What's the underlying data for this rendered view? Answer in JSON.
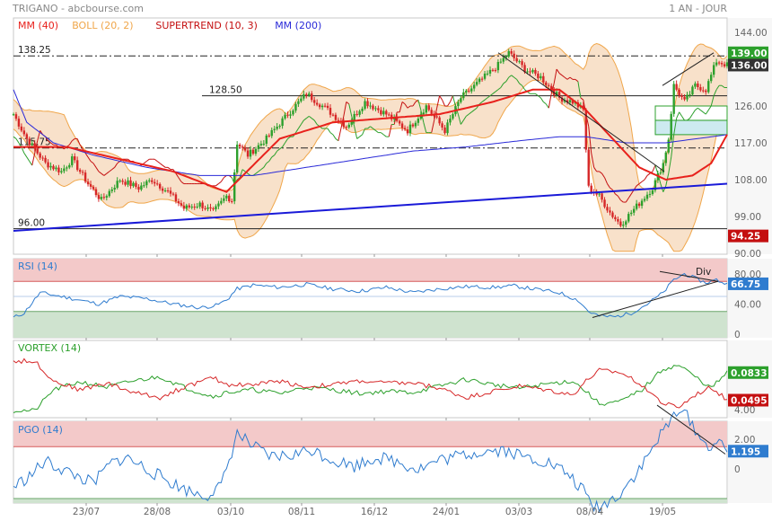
{
  "header": {
    "title": "TRIGANO - abcbourse.com",
    "period": "1 AN - JOUR"
  },
  "colors": {
    "mm40": "#e8211c",
    "boll": "#f0a64a",
    "supertrend": "#c40f10",
    "mm200": "#2a2ad8",
    "up": "#2ca02c",
    "down": "#d62728",
    "rsi": "#2f7ccf",
    "vortex_plus": "#2ca02c",
    "vortex_minus": "#d62728",
    "pgo": "#2f7ccf",
    "zone_high": "#f3c9c9",
    "zone_low": "#cfe3cf"
  },
  "x_axis": {
    "labels": [
      "23/07",
      "28/08",
      "03/10",
      "08/11",
      "16/12",
      "24/01",
      "03/03",
      "08/04",
      "19/05"
    ]
  },
  "chart_data": [
    {
      "type": "candlestick",
      "panel": "price",
      "legend": [
        {
          "name": "MM (40)",
          "color": "#e8211c"
        },
        {
          "name": "BOLL (20, 2)",
          "color": "#f0a64a"
        },
        {
          "name": "SUPERTREND (10, 3)",
          "color": "#c40f10"
        },
        {
          "name": "MM (200)",
          "color": "#2a2ad8"
        }
      ],
      "yticks": [
        90.0,
        99.0,
        108.0,
        117.0,
        126.0,
        135.0,
        144.0
      ],
      "ylim": [
        90,
        144
      ],
      "ytick_labels": [
        "90.00",
        "99.00",
        "108.00",
        "117.00",
        "126.00",
        "",
        "144.00"
      ],
      "hlines": [
        {
          "label": "138.25",
          "value": 138.25,
          "style": "dashdot"
        },
        {
          "label": "128.50",
          "value": 128.5,
          "style": "solid"
        },
        {
          "label": "115.75",
          "value": 115.75,
          "style": "dashdot"
        },
        {
          "label": "96.00",
          "value": 96.0,
          "style": "solid"
        }
      ],
      "last_values": [
        {
          "label": "139.00",
          "value": 139.0,
          "color": "#2ca02c"
        },
        {
          "label": "136.00",
          "value": 136.0,
          "color": "#333333"
        },
        {
          "label": "94.25",
          "value": 94.25,
          "color": "#c40f10"
        }
      ],
      "anchors_close": [
        [
          0,
          124
        ],
        [
          5,
          118
        ],
        [
          12,
          112
        ],
        [
          18,
          110
        ],
        [
          22,
          113
        ],
        [
          28,
          107
        ],
        [
          33,
          103
        ],
        [
          40,
          108
        ],
        [
          47,
          106
        ],
        [
          52,
          108
        ],
        [
          58,
          105
        ],
        [
          64,
          101
        ],
        [
          70,
          102
        ],
        [
          75,
          100
        ],
        [
          80,
          104
        ],
        [
          82,
          103
        ],
        [
          84,
          117
        ],
        [
          88,
          114
        ],
        [
          95,
          118
        ],
        [
          103,
          124
        ],
        [
          110,
          129
        ],
        [
          118,
          125
        ],
        [
          125,
          121
        ],
        [
          132,
          127
        ],
        [
          140,
          124
        ],
        [
          148,
          120
        ],
        [
          155,
          126
        ],
        [
          162,
          120
        ],
        [
          168,
          128
        ],
        [
          175,
          132
        ],
        [
          182,
          136
        ],
        [
          186,
          139
        ],
        [
          192,
          135
        ],
        [
          198,
          133
        ],
        [
          205,
          128
        ],
        [
          210,
          127
        ],
        [
          214,
          125
        ],
        [
          216,
          106
        ],
        [
          220,
          104
        ],
        [
          224,
          100
        ],
        [
          228,
          97
        ],
        [
          232,
          100
        ],
        [
          236,
          103
        ],
        [
          240,
          106
        ],
        [
          244,
          112
        ],
        [
          246,
          118
        ],
        [
          248,
          131
        ],
        [
          252,
          127
        ],
        [
          256,
          131
        ],
        [
          260,
          130
        ],
        [
          264,
          137
        ],
        [
          268,
          136
        ]
      ],
      "anchors_mm40": [
        [
          0,
          116
        ],
        [
          20,
          116
        ],
        [
          40,
          113
        ],
        [
          60,
          110
        ],
        [
          80,
          105
        ],
        [
          100,
          118
        ],
        [
          120,
          122
        ],
        [
          140,
          123
        ],
        [
          160,
          124
        ],
        [
          180,
          127
        ],
        [
          195,
          130
        ],
        [
          205,
          130
        ],
        [
          215,
          125
        ],
        [
          225,
          118
        ],
        [
          235,
          111
        ],
        [
          245,
          108
        ],
        [
          255,
          109
        ],
        [
          262,
          112
        ],
        [
          268,
          119
        ]
      ],
      "anchors_mm200": [
        [
          0,
          130
        ],
        [
          5,
          122
        ],
        [
          15,
          117
        ],
        [
          30,
          114
        ],
        [
          50,
          111
        ],
        [
          70,
          109
        ],
        [
          90,
          109
        ],
        [
          110,
          111
        ],
        [
          130,
          113
        ],
        [
          150,
          115
        ],
        [
          170,
          116
        ],
        [
          190,
          117.5
        ],
        [
          205,
          118.5
        ],
        [
          215,
          118.5
        ],
        [
          230,
          117
        ],
        [
          245,
          117
        ],
        [
          268,
          119
        ]
      ],
      "trendline_support": {
        "points": [
          [
            0,
            95.5
          ],
          [
            268,
            107
          ]
        ],
        "color": "#1a1ad8"
      }
    },
    {
      "type": "line",
      "panel": "rsi",
      "legend": [
        {
          "name": "RSI (14)",
          "color": "#2f7ccf"
        }
      ],
      "yticks": [
        0,
        40,
        80
      ],
      "ytick_labels": [
        "0",
        "40.00",
        "80.00"
      ],
      "ylim": [
        0,
        100
      ],
      "zones": [
        {
          "from": 70,
          "to": 100,
          "color": "#f3c9c9"
        },
        {
          "from": 0,
          "to": 30,
          "color": "#cfe3cf"
        }
      ],
      "midline": 50,
      "last_values": [
        {
          "label": "66.75",
          "value": 66.75,
          "color": "#2f7ccf"
        }
      ],
      "annotation": "Div",
      "anchors": [
        [
          0,
          22
        ],
        [
          4,
          28
        ],
        [
          10,
          55
        ],
        [
          18,
          50
        ],
        [
          25,
          45
        ],
        [
          32,
          40
        ],
        [
          40,
          50
        ],
        [
          50,
          47
        ],
        [
          60,
          40
        ],
        [
          70,
          35
        ],
        [
          76,
          38
        ],
        [
          80,
          45
        ],
        [
          84,
          60
        ],
        [
          90,
          65
        ],
        [
          100,
          62
        ],
        [
          110,
          66
        ],
        [
          120,
          60
        ],
        [
          130,
          57
        ],
        [
          140,
          62
        ],
        [
          150,
          55
        ],
        [
          160,
          60
        ],
        [
          170,
          63
        ],
        [
          180,
          62
        ],
        [
          188,
          64
        ],
        [
          195,
          60
        ],
        [
          205,
          55
        ],
        [
          212,
          45
        ],
        [
          216,
          30
        ],
        [
          220,
          24
        ],
        [
          226,
          23
        ],
        [
          232,
          28
        ],
        [
          238,
          40
        ],
        [
          244,
          55
        ],
        [
          248,
          72
        ],
        [
          252,
          80
        ],
        [
          256,
          74
        ],
        [
          260,
          68
        ],
        [
          264,
          72
        ],
        [
          268,
          66
        ]
      ]
    },
    {
      "type": "line",
      "panel": "vortex",
      "legend": [
        {
          "name": "VORTEX (14)",
          "color": "#2ca02c"
        }
      ],
      "ylim": [
        0,
        1
      ],
      "series": [
        {
          "name": "",
          "color": "#2ca02c",
          "anchors": [
            [
              0,
              0.05
            ],
            [
              8,
              0.05
            ],
            [
              15,
              0.45
            ],
            [
              25,
              0.6
            ],
            [
              35,
              0.5
            ],
            [
              45,
              0.62
            ],
            [
              55,
              0.7
            ],
            [
              65,
              0.48
            ],
            [
              75,
              0.32
            ],
            [
              80,
              0.4
            ],
            [
              90,
              0.45
            ],
            [
              100,
              0.38
            ],
            [
              110,
              0.5
            ],
            [
              120,
              0.45
            ],
            [
              130,
              0.38
            ],
            [
              140,
              0.42
            ],
            [
              150,
              0.4
            ],
            [
              160,
              0.52
            ],
            [
              170,
              0.65
            ],
            [
              180,
              0.55
            ],
            [
              190,
              0.48
            ],
            [
              200,
              0.56
            ],
            [
              210,
              0.62
            ],
            [
              215,
              0.42
            ],
            [
              220,
              0.18
            ],
            [
              228,
              0.22
            ],
            [
              236,
              0.45
            ],
            [
              244,
              0.85
            ],
            [
              250,
              0.92
            ],
            [
              256,
              0.7
            ],
            [
              262,
              0.48
            ],
            [
              268,
              0.78
            ]
          ]
        },
        {
          "name": "",
          "color": "#d62728",
          "anchors": [
            [
              0,
              1.0
            ],
            [
              8,
              1.0
            ],
            [
              15,
              0.62
            ],
            [
              25,
              0.45
            ],
            [
              35,
              0.58
            ],
            [
              45,
              0.4
            ],
            [
              55,
              0.3
            ],
            [
              65,
              0.52
            ],
            [
              75,
              0.68
            ],
            [
              80,
              0.55
            ],
            [
              90,
              0.55
            ],
            [
              100,
              0.62
            ],
            [
              110,
              0.5
            ],
            [
              120,
              0.55
            ],
            [
              130,
              0.62
            ],
            [
              140,
              0.58
            ],
            [
              150,
              0.58
            ],
            [
              160,
              0.48
            ],
            [
              170,
              0.3
            ],
            [
              180,
              0.42
            ],
            [
              190,
              0.52
            ],
            [
              200,
              0.45
            ],
            [
              210,
              0.35
            ],
            [
              215,
              0.62
            ],
            [
              220,
              0.82
            ],
            [
              228,
              0.78
            ],
            [
              236,
              0.55
            ],
            [
              244,
              0.18
            ],
            [
              250,
              0.12
            ],
            [
              256,
              0.35
            ],
            [
              262,
              0.5
            ],
            [
              268,
              0.25
            ]
          ]
        }
      ],
      "last_values": [
        {
          "label": "0.0833",
          "value": 0.78,
          "color": "#2ca02c"
        },
        {
          "label": "0.0495",
          "value": 0.25,
          "color": "#c40f10"
        }
      ]
    },
    {
      "type": "line",
      "panel": "pgo",
      "legend": [
        {
          "name": "PGO (14)",
          "color": "#2f7ccf"
        }
      ],
      "yticks": [
        0,
        2,
        4
      ],
      "ytick_labels": [
        "0",
        "2.00",
        "4.00"
      ],
      "ylim": [
        -3.5,
        5.5
      ],
      "zones": [
        {
          "from": 1.5,
          "to": 5.5,
          "color": "#f3c9c9"
        },
        {
          "from": -3.5,
          "to": -2.0,
          "color": "#cfe3cf"
        }
      ],
      "midline": 0,
      "last_values": [
        {
          "label": "1.195",
          "value": 1.195,
          "color": "#2f7ccf"
        }
      ],
      "anchors": [
        [
          0,
          -1.2
        ],
        [
          6,
          -0.5
        ],
        [
          12,
          0.5
        ],
        [
          18,
          0.0
        ],
        [
          24,
          -0.5
        ],
        [
          30,
          -1.0
        ],
        [
          36,
          0.3
        ],
        [
          42,
          0.8
        ],
        [
          48,
          0.2
        ],
        [
          54,
          -0.4
        ],
        [
          60,
          -1.0
        ],
        [
          66,
          -1.5
        ],
        [
          72,
          -1.8
        ],
        [
          78,
          -1.2
        ],
        [
          82,
          1.2
        ],
        [
          84,
          2.4
        ],
        [
          90,
          1.5
        ],
        [
          96,
          0.8
        ],
        [
          104,
          0.9
        ],
        [
          112,
          1.3
        ],
        [
          120,
          0.6
        ],
        [
          128,
          0.2
        ],
        [
          136,
          0.8
        ],
        [
          144,
          0.5
        ],
        [
          152,
          0.0
        ],
        [
          160,
          0.6
        ],
        [
          168,
          0.9
        ],
        [
          176,
          1.2
        ],
        [
          184,
          1.3
        ],
        [
          192,
          0.8
        ],
        [
          200,
          0.5
        ],
        [
          208,
          -0.3
        ],
        [
          214,
          -1.5
        ],
        [
          218,
          -2.6
        ],
        [
          222,
          -2.4
        ],
        [
          228,
          -1.6
        ],
        [
          236,
          0.2
        ],
        [
          242,
          2.0
        ],
        [
          246,
          3.0
        ],
        [
          250,
          4.2
        ],
        [
          255,
          3.0
        ],
        [
          260,
          1.5
        ],
        [
          264,
          1.8
        ],
        [
          268,
          1.2
        ]
      ]
    }
  ]
}
